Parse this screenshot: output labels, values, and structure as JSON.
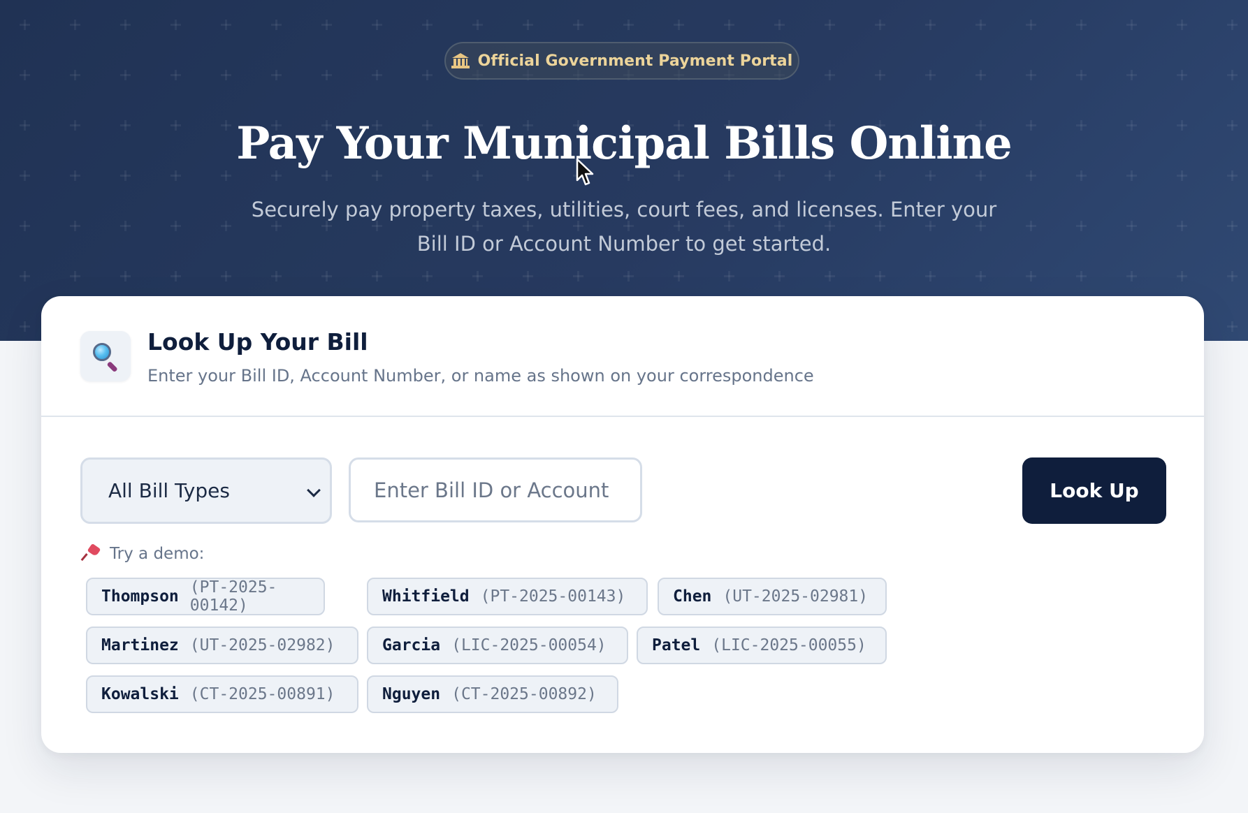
{
  "hero": {
    "badge_text": "Official Government Payment Portal",
    "badge_icon": "government-building-icon",
    "title": "Pay Your Municipal Bills Online",
    "subtitle": "Securely pay property taxes, utilities, court fees, and licenses. Enter your Bill ID or Account Number to get started."
  },
  "lookup_card": {
    "icon": "magnifying-glass-icon",
    "title": "Look Up Your Bill",
    "description": "Enter your Bill ID, Account Number, or name as shown on your correspondence",
    "bill_type_select": {
      "selected": "All Bill Types"
    },
    "search": {
      "value": "",
      "placeholder": "Enter Bill ID or Account"
    },
    "lookup_button_label": "Look Up",
    "demo": {
      "icon": "pushpin-icon",
      "label": "Try a demo:",
      "items": [
        {
          "name": "Thompson",
          "code": "(PT-2025-00142)"
        },
        {
          "name": "Whitfield",
          "code": "(PT-2025-00143)"
        },
        {
          "name": "Chen",
          "code": "(UT-2025-02981)"
        },
        {
          "name": "Martinez",
          "code": "(UT-2025-02982)"
        },
        {
          "name": "Garcia",
          "code": "(LIC-2025-00054)"
        },
        {
          "name": "Patel",
          "code": "(LIC-2025-00055)"
        },
        {
          "name": "Kowalski",
          "code": "(CT-2025-00891)"
        },
        {
          "name": "Nguyen",
          "code": "(CT-2025-00892)"
        }
      ]
    }
  },
  "colors": {
    "hero_background": "#13264a",
    "badge_text": "#ecd49a",
    "primary_button": "#0f1e3c",
    "card_background": "#ffffff",
    "chip_background": "#eef2f7"
  }
}
